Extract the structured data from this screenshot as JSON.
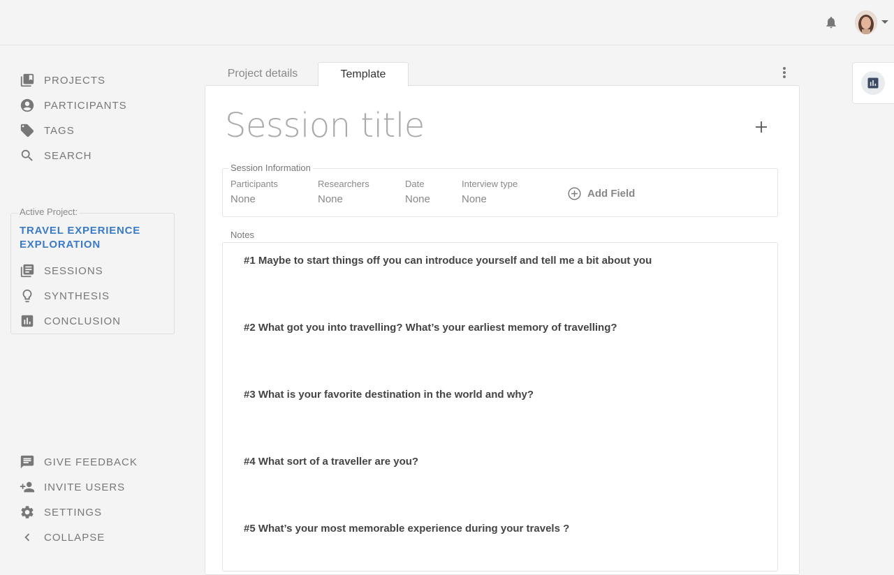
{
  "sidebar": {
    "main_nav": [
      {
        "label": "PROJECTS",
        "icon": "projects-icon"
      },
      {
        "label": "PARTICIPANTS",
        "icon": "participant-icon"
      },
      {
        "label": "TAGS",
        "icon": "tag-icon"
      },
      {
        "label": "SEARCH",
        "icon": "search-icon"
      }
    ],
    "active_project_label": "Active Project:",
    "active_project_name": "TRAVEL EXPERIENCE EXPLORATION",
    "project_nav": [
      {
        "label": "SESSIONS",
        "icon": "sessions-icon"
      },
      {
        "label": "SYNTHESIS",
        "icon": "lightbulb-icon"
      },
      {
        "label": "CONCLUSION",
        "icon": "chart-icon"
      }
    ],
    "bottom_nav": [
      {
        "label": "GIVE FEEDBACK",
        "icon": "feedback-icon"
      },
      {
        "label": "INVITE USERS",
        "icon": "add-user-icon"
      },
      {
        "label": "SETTINGS",
        "icon": "gear-icon"
      },
      {
        "label": "COLLAPSE",
        "icon": "chevron-left-icon"
      }
    ]
  },
  "tabs": [
    {
      "label": "Project details",
      "active": false
    },
    {
      "label": "Template",
      "active": true
    }
  ],
  "editor": {
    "title_placeholder": "Session title",
    "session_info": {
      "legend": "Session Information",
      "fields": [
        {
          "label": "Participants",
          "value": "None"
        },
        {
          "label": "Researchers",
          "value": "None"
        },
        {
          "label": "Date",
          "value": "None"
        },
        {
          "label": "Interview type",
          "value": "None"
        }
      ],
      "add_field_label": "Add Field"
    },
    "notes_label": "Notes",
    "questions": [
      "#1 Maybe to start things off you can introduce yourself and tell me a bit about you",
      "#2 What got you into travelling? What’s your earliest memory of travelling?",
      "#3 What is your favorite destination in the world and why?",
      "#4 What sort of a traveller are you?",
      "#5 What’s your most memorable experience during your travels ?"
    ]
  },
  "colors": {
    "accent": "#3a7ac7",
    "icon": "#777777",
    "chart_chip": "#3c4a63"
  }
}
